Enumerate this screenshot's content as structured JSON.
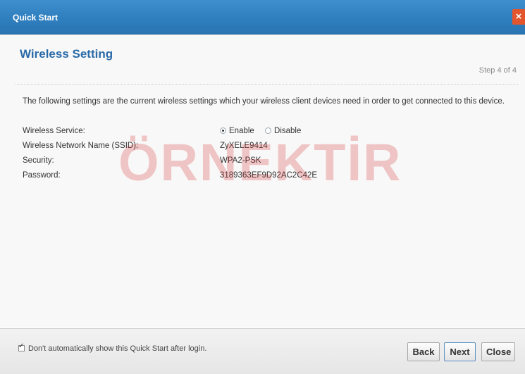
{
  "window": {
    "title": "Quick Start",
    "close_icon": "close-icon",
    "close_glyph": "×"
  },
  "page": {
    "heading": "Wireless Setting",
    "step": "Step 4 of 4",
    "intro": "The following settings are the current wireless settings which your wireless client devices need in order to get connected to this device."
  },
  "settings": {
    "wireless_service_label": "Wireless Service:",
    "enable_label": "Enable",
    "disable_label": "Disable",
    "selected": "Enable",
    "ssid_label": "Wireless Network Name (SSID):",
    "ssid_value": "ZyXELE9414",
    "security_label": "Security:",
    "security_value": "WPA2-PSK",
    "password_label": "Password:",
    "password_value": "3189363EF9D92AC2C42E"
  },
  "watermark": "ÖRNEKTİR",
  "footer": {
    "dont_show_label": "Don't automatically show this Quick Start after login.",
    "dont_show_checked": true,
    "back": "Back",
    "next": "Next",
    "close": "Close"
  }
}
